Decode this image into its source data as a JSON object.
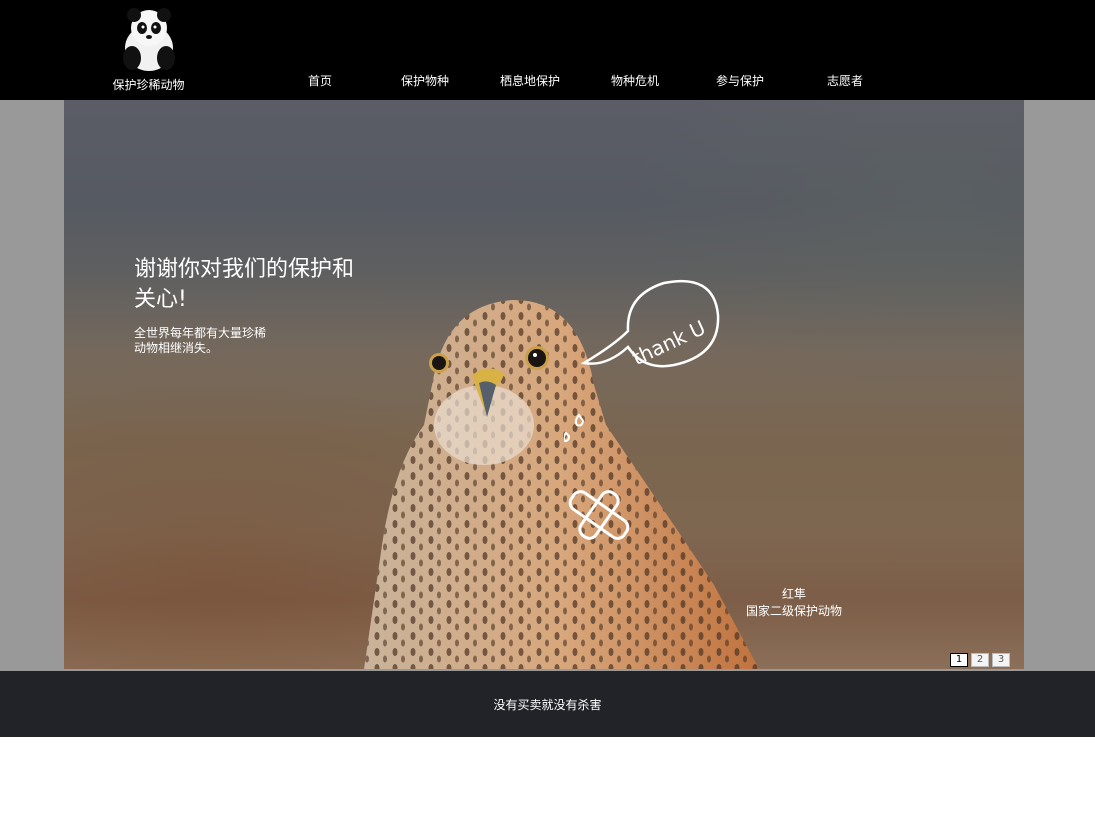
{
  "header": {
    "logo_text": "保护珍稀动物",
    "nav": [
      {
        "label": "首页"
      },
      {
        "label": "保护物种"
      },
      {
        "label": "栖息地保护"
      },
      {
        "label": "物种危机"
      },
      {
        "label": "参与保护"
      },
      {
        "label": "志愿者"
      }
    ]
  },
  "slide": {
    "headline": "谢谢你对我们的保护和关心!",
    "subline": "全世界每年都有大量珍稀动物相继消失。",
    "bubble_text": "thank U",
    "caption_name": "红隼",
    "caption_status": "国家二级保护动物",
    "pager": [
      "1",
      "2",
      "3"
    ],
    "active_page": "1"
  },
  "footer": {
    "text": "没有买卖就没有杀害"
  },
  "colors": {
    "header_bg": "#000000",
    "hero_band": "#999999",
    "footer_bg": "#212329",
    "text": "#ffffff"
  },
  "icons": {
    "logo": "panda-icon",
    "doodle": "speech-bubble-tears-bandage-doodle"
  }
}
